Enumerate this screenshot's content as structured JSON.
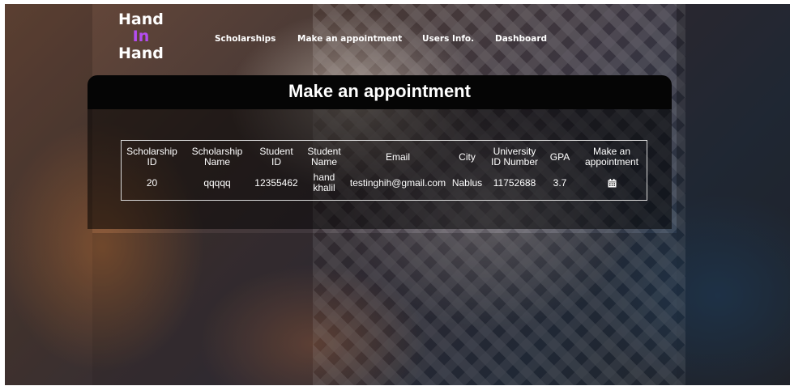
{
  "brand": {
    "line1": "Hand",
    "line2": "In",
    "line3": "Hand",
    "accent_color": "#b44df0"
  },
  "nav": {
    "items": [
      {
        "label": "Scholarships"
      },
      {
        "label": "Make an appointment"
      },
      {
        "label": "Users Info."
      },
      {
        "label": "Dashboard"
      }
    ]
  },
  "page": {
    "title": "Make an appointment"
  },
  "table": {
    "headers": [
      {
        "line1": "Scholarship",
        "line2": "ID"
      },
      {
        "line1": "Scholarship",
        "line2": "Name"
      },
      {
        "line1": "Student",
        "line2": "ID"
      },
      {
        "line1": "Student",
        "line2": "Name"
      },
      {
        "line1": "Email",
        "line2": ""
      },
      {
        "line1": "City",
        "line2": ""
      },
      {
        "line1": "University",
        "line2": "ID Number"
      },
      {
        "line1": "GPA",
        "line2": ""
      },
      {
        "line1": "Make an",
        "line2": "appointment"
      }
    ],
    "rows": [
      {
        "scholarship_id": "20",
        "scholarship_name": "qqqqq",
        "student_id": "12355462",
        "student_name_line1": "hand",
        "student_name_line2": "khalil",
        "email": "testinghih@gmail.com",
        "city": "Nablus",
        "university_id": "11752688",
        "gpa": "3.7",
        "action_icon": "calendar-icon"
      }
    ]
  }
}
